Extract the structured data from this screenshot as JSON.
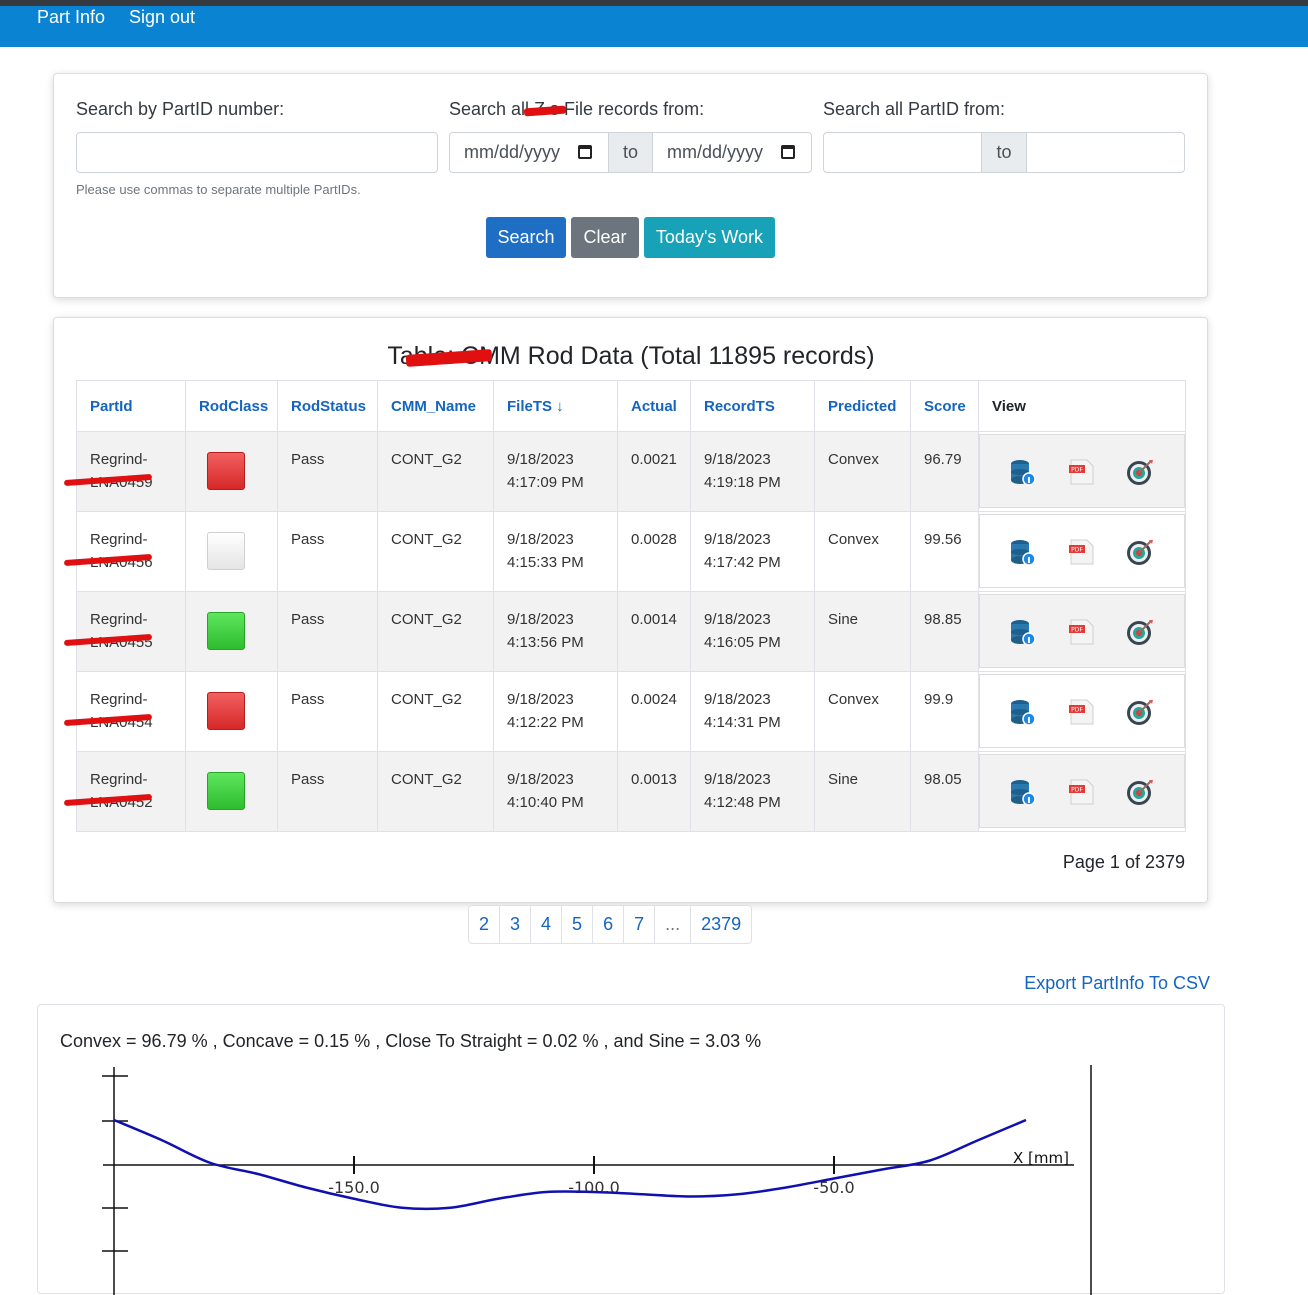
{
  "nav": {
    "part_info": "Part Info",
    "sign_out": "Sign out"
  },
  "search": {
    "partid_label": "Search by PartID number:",
    "file_label": "Search all Z  s File records from:",
    "partid_range_label": "Search all PartID from:",
    "date_placeholder": "mm/dd/yyyy",
    "to_label": "to",
    "help_text": "Please use commas to separate multiple PartIDs.",
    "buttons": {
      "search": "Search",
      "clear": "Clear",
      "today": "Today's Work"
    }
  },
  "table": {
    "title": "Table:         CMM Rod Data (Total 11895 records)",
    "columns": [
      "PartId",
      "RodClass",
      "RodStatus",
      "CMM_Name",
      "FileTS ↓",
      "Actual",
      "RecordTS",
      "Predicted",
      "Score",
      "View"
    ],
    "rows": [
      {
        "partid": "Regrind-",
        "partid2": "LNA0459",
        "rodclass": "red",
        "status": "Pass",
        "cmm": "CONT_G2",
        "filets_date": "9/18/2023",
        "filets_time": "4:17:09 PM",
        "actual": "0.0021",
        "recordts_date": "9/18/2023",
        "recordts_time": "4:19:18 PM",
        "predicted": "Convex",
        "score": "96.79"
      },
      {
        "partid": "Regrind-",
        "partid2": "LNA0456",
        "rodclass": "white",
        "status": "Pass",
        "cmm": "CONT_G2",
        "filets_date": "9/18/2023",
        "filets_time": "4:15:33 PM",
        "actual": "0.0028",
        "recordts_date": "9/18/2023",
        "recordts_time": "4:17:42 PM",
        "predicted": "Convex",
        "score": "99.56"
      },
      {
        "partid": "Regrind-",
        "partid2": "LNA0455",
        "rodclass": "green",
        "status": "Pass",
        "cmm": "CONT_G2",
        "filets_date": "9/18/2023",
        "filets_time": "4:13:56 PM",
        "actual": "0.0014",
        "recordts_date": "9/18/2023",
        "recordts_time": "4:16:05 PM",
        "predicted": "Sine",
        "score": "98.85"
      },
      {
        "partid": "Regrind-",
        "partid2": "LNA0454",
        "rodclass": "red",
        "status": "Pass",
        "cmm": "CONT_G2",
        "filets_date": "9/18/2023",
        "filets_time": "4:12:22 PM",
        "actual": "0.0024",
        "recordts_date": "9/18/2023",
        "recordts_time": "4:14:31 PM",
        "predicted": "Convex",
        "score": "99.9"
      },
      {
        "partid": "Regrind-",
        "partid2": "LNA0452",
        "rodclass": "green",
        "status": "Pass",
        "cmm": "CONT_G2",
        "filets_date": "9/18/2023",
        "filets_time": "4:10:40 PM",
        "actual": "0.0013",
        "recordts_date": "9/18/2023",
        "recordts_time": "4:12:48 PM",
        "predicted": "Sine",
        "score": "98.05"
      }
    ],
    "page_info": "Page 1 of 2379"
  },
  "pagination": [
    "2",
    "3",
    "4",
    "5",
    "6",
    "7",
    "...",
    "2379"
  ],
  "export_link": "Export PartInfo To CSV",
  "colors": {
    "nav": "#0a84d2",
    "search": "#1e6fc4",
    "clear": "#6c757d",
    "today": "#17a2b8",
    "curve": "#1010b0"
  },
  "chart": {
    "summary": "Convex = 96.79 % , Concave = 0.15 % , Close To Straight = 0.02 % , and Sine = 3.03 %",
    "x_axis_label": "X [mm]",
    "ticks": [
      "-150.0",
      "-100.0",
      "-50.0"
    ]
  },
  "chart_data": {
    "type": "line",
    "xlabel": "X [mm]",
    "ylabel": "",
    "xlim": [
      -200,
      0
    ],
    "x_ticks": [
      -150,
      -100,
      -50
    ],
    "series": [
      {
        "values_x": [
          -200,
          -190,
          -180,
          -170,
          -160,
          -150,
          -140,
          -130,
          -120,
          -110,
          -100,
          -90,
          -80,
          -70,
          -60,
          -50,
          -40,
          -30,
          -20,
          -10
        ],
        "values_y": [
          1.0,
          0.55,
          0.05,
          -0.2,
          -0.5,
          -0.75,
          -0.95,
          -0.95,
          -0.75,
          -0.6,
          -0.6,
          -0.65,
          -0.7,
          -0.65,
          -0.5,
          -0.3,
          -0.1,
          0.1,
          0.55,
          1.0
        ]
      }
    ]
  }
}
